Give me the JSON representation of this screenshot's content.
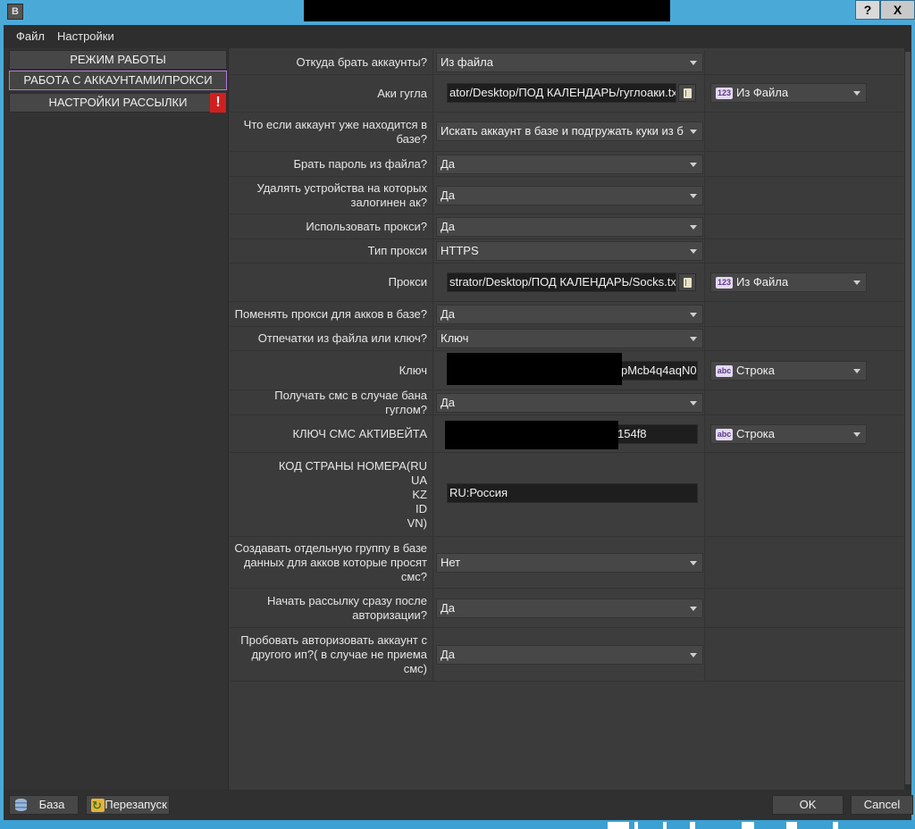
{
  "window": {
    "app_icon": "B",
    "help_label": "?",
    "close_label": "X"
  },
  "menu": {
    "items": [
      "Файл",
      "Настройки"
    ]
  },
  "sidebar": {
    "items": [
      {
        "label": "РЕЖИМ РАБОТЫ",
        "active": false
      },
      {
        "label": "РАБОТА С АККАУНТАМИ/ПРОКСИ",
        "active": true
      },
      {
        "label": "НАСТРОЙКИ РАССЫЛКИ",
        "active": false,
        "warning": "!"
      }
    ]
  },
  "settings": {
    "accounts_source": {
      "label": "Откуда брать аккаунты?",
      "value": "Из файла"
    },
    "google_accounts": {
      "label": "Аки гугла",
      "path": "ator/Desktop/ПОД КАЛЕНДАРЬ/гуглоаки.txt",
      "type_badge": "123",
      "type_value": "Из Файла"
    },
    "account_in_db": {
      "label": "Что если аккаунт уже находится в базе?",
      "value": "Искать аккаунт в базе и подгружать куки из б"
    },
    "password_from_file": {
      "label": "Брать пароль из файла?",
      "value": "Да"
    },
    "delete_devices": {
      "label": "Удалять устройства на которых залогинен ак?",
      "value": "Да"
    },
    "use_proxy": {
      "label": "Использовать прокси?",
      "value": "Да"
    },
    "proxy_type": {
      "label": "Тип прокси",
      "value": "HTTPS"
    },
    "proxy": {
      "label": "Прокси",
      "path": "strator/Desktop/ПОД КАЛЕНДАРЬ/Socks.txt",
      "type_badge": "123",
      "type_value": "Из Файла"
    },
    "change_proxy": {
      "label": "Поменять прокси для акков в базе?",
      "value": "Да"
    },
    "fingerprints": {
      "label": "Отпечатки из файла или ключ?",
      "value": "Ключ"
    },
    "key": {
      "label": "Ключ",
      "value": "pMcb4q4aqN0",
      "type_badge": "abc",
      "type_value": "Строка"
    },
    "sms_on_ban": {
      "label": "Получать смс в случае бана гуглом?",
      "value": "Да"
    },
    "sms_activate_key": {
      "label": "КЛЮЧ СМС АКТИВЕЙТА",
      "value": "154f8",
      "type_badge": "abc",
      "type_value": "Строка"
    },
    "country_code": {
      "label_lines": [
        "КОД СТРАНЫ НОМЕРА(RU",
        "UA",
        "KZ",
        "ID",
        "VN)"
      ],
      "value": "RU:Россия"
    },
    "separate_group": {
      "label": "Создавать отдельную группу в базе данных для акков которые просят смс?",
      "value": "Нет"
    },
    "start_after_auth": {
      "label": "Начать рассылку сразу после авторизации?",
      "value": "Да"
    },
    "try_other_ip": {
      "label": "Пробовать авторизовать аккаунт с другого ип?( в случае не приема смс)",
      "value": "Да"
    }
  },
  "footer": {
    "db_label": "База",
    "restart_label": "Перезапуск",
    "ok_label": "OK",
    "cancel_label": "Cancel"
  }
}
